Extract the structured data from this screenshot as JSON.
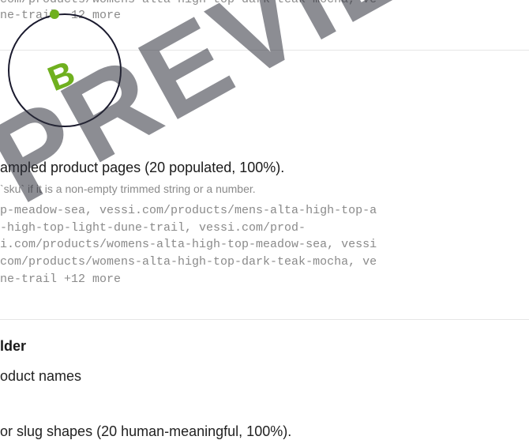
{
  "top_urls": {
    "line1": "com/products/womens-alta-high-top-dark-teak-mocha, ve",
    "line2": "ne-trail  12 more"
  },
  "grade": {
    "letter": "B",
    "color": "#6fb01f"
  },
  "sku_section": {
    "title": "ampled product pages (20 populated, 100%).",
    "rule": "`sku` if it is a non-empty trimmed string or a number.",
    "lines": [
      "p-meadow-sea, vessi.com/products/mens-alta-high-top-a",
      "-high-top-light-dune-trail, vessi.com/prod-",
      "i.com/products/womens-alta-high-top-meadow-sea, vessi",
      "com/products/womens-alta-high-top-dark-teak-mocha, ve",
      "ne-trail +12 more"
    ]
  },
  "name_section": {
    "title": "lder",
    "subtitle": "oduct names"
  },
  "slug_section": {
    "title": "or slug shapes (20 human-meaningful, 100%)."
  },
  "watermark": "PREVIEW"
}
